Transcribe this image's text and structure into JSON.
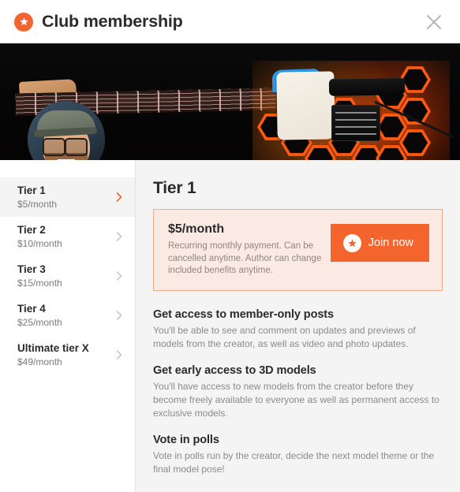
{
  "header": {
    "title": "Club membership",
    "brand_icon": "star-badge-icon",
    "close_icon": "close-icon",
    "accent_color": "#f26430"
  },
  "hero": {
    "alt": "electric guitar with orange 3d printed honeycomb body",
    "avatar_alt": "creator profile photo"
  },
  "sidebar": {
    "tiers": [
      {
        "name": "Tier 1",
        "price": "$5/month",
        "selected": true
      },
      {
        "name": "Tier 2",
        "price": "$10/month",
        "selected": false
      },
      {
        "name": "Tier 3",
        "price": "$15/month",
        "selected": false
      },
      {
        "name": "Tier 4",
        "price": "$25/month",
        "selected": false
      },
      {
        "name": "Ultimate tier X",
        "price": "$49/month",
        "selected": false
      }
    ]
  },
  "main": {
    "title": "Tier 1",
    "price_card": {
      "amount": "$5/month",
      "note": "Recurring monthly payment. Can be cancelled anytime. Author can change included benefits anytime.",
      "join_label": "Join now",
      "join_icon": "star-badge-icon",
      "border_color": "#f0a98c",
      "background_color": "#fbeae4",
      "button_color": "#f4642d"
    },
    "benefits": [
      {
        "title": "Get access to member-only posts",
        "text": "You'll be able to see and comment on updates and previews of models from the creator, as well as video and photo updates."
      },
      {
        "title": "Get early access to 3D models",
        "text": "You'll have access to new models from the creator before they become freely available to everyone as well as permanent access to exclusive models."
      },
      {
        "title": "Vote in polls",
        "text": "Vote in polls run by the creator, decide the next model theme or the final model pose!"
      }
    ]
  }
}
